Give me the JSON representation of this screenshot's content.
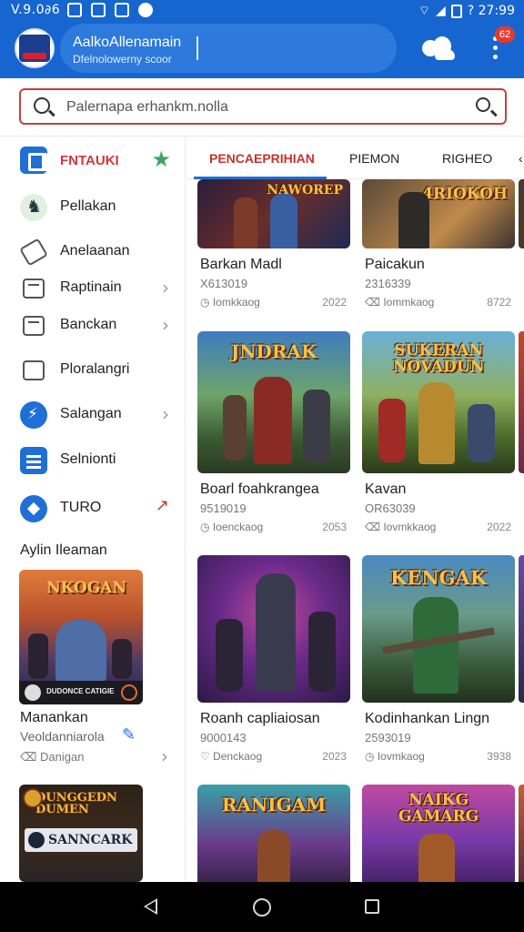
{
  "status_bar": {
    "time": "V.9.0∂6",
    "battery_text": "? 27:99"
  },
  "header": {
    "title": "AalkoAllenamain",
    "subtitle": "Dfelnolowerny scoor",
    "notification_count": "62"
  },
  "search": {
    "placeholder": "Palernapa erhankm.nolla"
  },
  "sidebar": {
    "items": [
      {
        "label": "FNTAUKI"
      },
      {
        "label": "Pellakan"
      },
      {
        "label": "Anelaanan"
      },
      {
        "label": "Raptinain"
      },
      {
        "label": "Banckan"
      },
      {
        "label": "Ploralangri"
      },
      {
        "label": "Salangan"
      },
      {
        "label": "Selnionti"
      },
      {
        "label": "TURO"
      }
    ],
    "section_title": "Aylin Ileaman",
    "featured": [
      {
        "name": "Manankan",
        "subtitle": "Veoldanniarola",
        "meta": "Danigan",
        "art_title": "NKOGAN",
        "art_caption": "DUDONCE CATIGIE"
      },
      {
        "name": "",
        "art_title": "DUNGGEDN DUMEN",
        "art_subtitle": "SANNCARK"
      }
    ]
  },
  "tabs": [
    "PENCAEPRIHIAN",
    "PIEMON",
    "RIGHEO"
  ],
  "games": [
    {
      "title": "Barkan Madl",
      "id": "X613019",
      "meta": "Iomkkaog",
      "year": "2022",
      "art_title": "NAWOREP"
    },
    {
      "title": "Paicakun",
      "id": "2316339",
      "meta": "Iommkaog",
      "year": "8722",
      "art_title": "4RIOKOH"
    },
    {
      "title": "Boarl foahkrangea",
      "id": "9519019",
      "meta": "Ioenckaog",
      "year": "2053",
      "art_title": "JNDRAK"
    },
    {
      "title": "Kavan",
      "id": "OR63039",
      "meta": "Iovmkkaog",
      "year": "2022",
      "art_title": "SUKERAN NOVADUN"
    },
    {
      "title": "Roanh capliaiosan",
      "id": "9000143",
      "meta": "Denckaog",
      "year": "2023",
      "art_title": ""
    },
    {
      "title": "Kodinhankan Lingn",
      "id": "2593019",
      "meta": "Iovmkaog",
      "year": "3938",
      "art_title": "KENGAK"
    },
    {
      "title": "",
      "art_title": "RANIGAM"
    },
    {
      "title": "",
      "art_title": "NAIKG GAMARG"
    }
  ]
}
